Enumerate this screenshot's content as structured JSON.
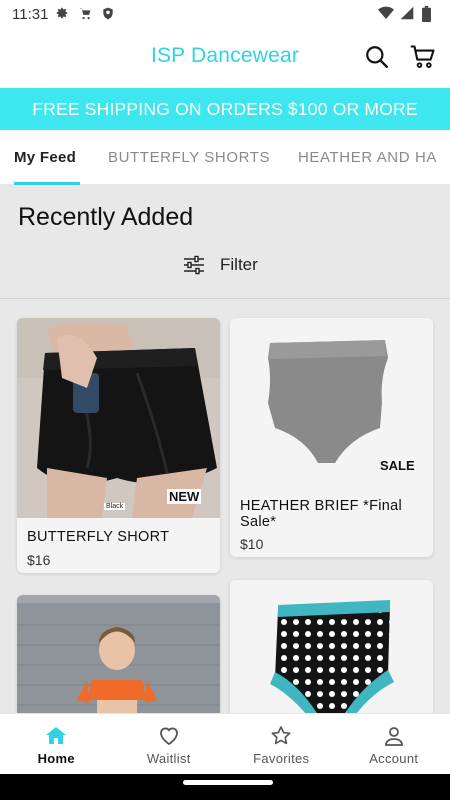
{
  "status_bar": {
    "time": "11:31",
    "left_icons": [
      "gear-icon",
      "cart-icon",
      "shield-icon"
    ],
    "right_icons": [
      "wifi-icon",
      "signal-icon",
      "battery-icon"
    ]
  },
  "app_bar": {
    "title": "ISP Dancewear",
    "actions": [
      "search-icon",
      "cart-icon"
    ]
  },
  "banner": {
    "text": "FREE SHIPPING ON ORDERS $100 OR MORE"
  },
  "tabs": [
    {
      "label": "My Feed",
      "active": true
    },
    {
      "label": "BUTTERFLY SHORTS",
      "active": false
    },
    {
      "label": "HEATHER AND HA",
      "active": false
    }
  ],
  "section": {
    "title": "Recently Added",
    "filter_label": "Filter"
  },
  "products": [
    {
      "name": "BUTTERFLY SHORT",
      "price": "$16",
      "badge": "NEW",
      "image_tag": "Black"
    },
    {
      "name": "HEATHER BRIEF *Final Sale*",
      "price": "$10",
      "badge": "SALE"
    },
    {
      "name": "",
      "price": ""
    },
    {
      "name": "",
      "price": ""
    }
  ],
  "bottom_nav": [
    {
      "label": "Home",
      "icon": "home-icon",
      "active": true
    },
    {
      "label": "Waitlist",
      "icon": "heart-icon",
      "active": false
    },
    {
      "label": "Favorites",
      "icon": "star-icon",
      "active": false
    },
    {
      "label": "Account",
      "icon": "person-icon",
      "active": false
    }
  ],
  "colors": {
    "brand": "#2fd4e0",
    "banner": "#3ee6f0"
  }
}
